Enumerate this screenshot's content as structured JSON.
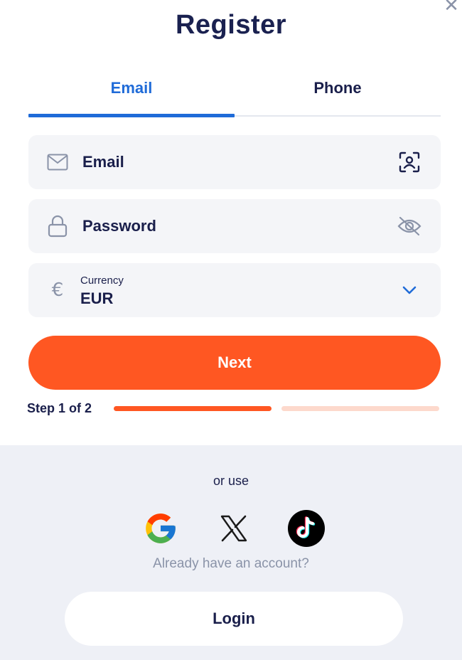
{
  "dialog": {
    "title": "Register",
    "close_icon": "close-icon"
  },
  "tabs": [
    {
      "label": "Email",
      "active": true
    },
    {
      "label": "Phone",
      "active": false
    }
  ],
  "form": {
    "email": {
      "placeholder": "Email",
      "icon": "mail-icon",
      "action_icon": "face-scan-icon"
    },
    "password": {
      "placeholder": "Password",
      "icon": "lock-icon",
      "action_icon": "eye-off-icon"
    },
    "currency": {
      "label": "Currency",
      "value": "EUR",
      "icon": "euro-icon",
      "action_icon": "chevron-down-icon"
    }
  },
  "next_button": {
    "label": "Next"
  },
  "progress": {
    "label": "Step 1 of 2",
    "current": 1,
    "total": 2
  },
  "social": {
    "or_use": "or use",
    "providers": [
      "google",
      "x",
      "tiktok"
    ],
    "already": "Already have an account?"
  },
  "login_button": {
    "label": "Login"
  },
  "colors": {
    "accent": "#ff5722",
    "tab_active": "#1f6bd8",
    "text": "#1a1f4b",
    "muted": "#8a93a8"
  }
}
